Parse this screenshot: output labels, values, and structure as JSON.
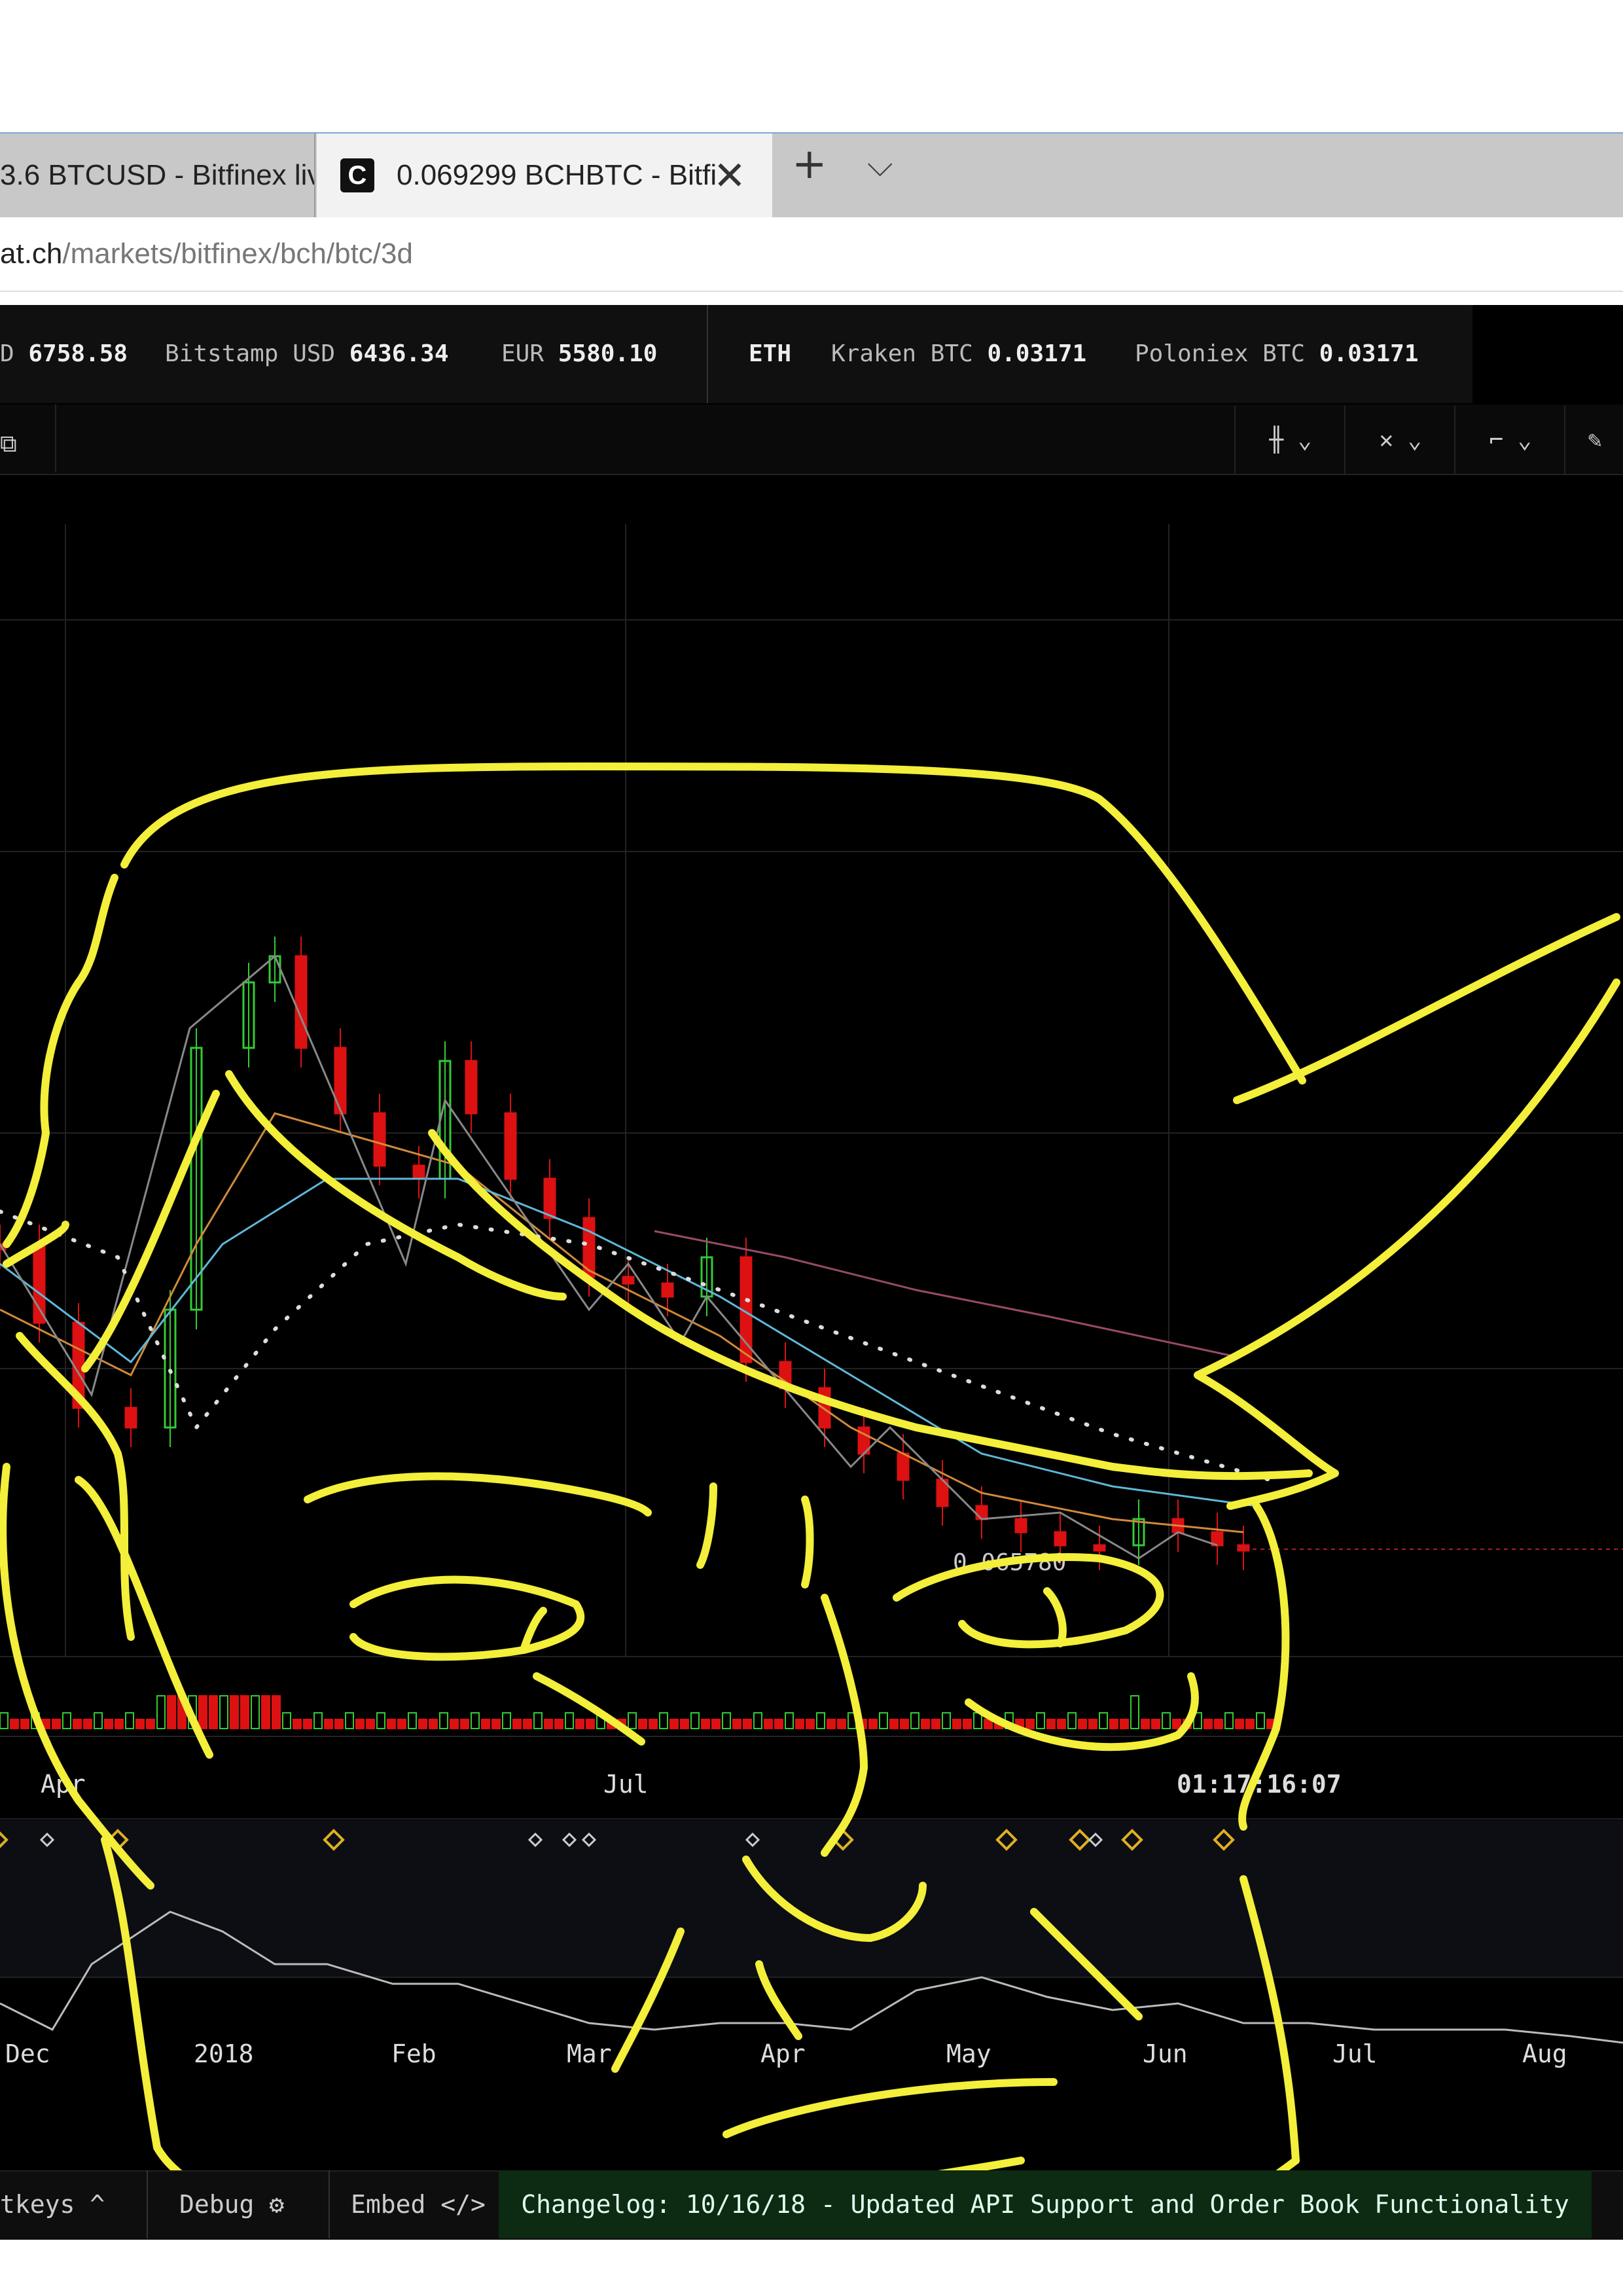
{
  "browser": {
    "tabs": [
      {
        "label": "3.6 BTCUSD - Bitfinex liv"
      },
      {
        "label": "0.069299 BCHBTC - Bitfi",
        "favicon": "C",
        "active": true
      }
    ],
    "new_tab_icon": "plus-icon",
    "tab_menu_icon": "chevron-down-icon",
    "address": {
      "host": "at.ch",
      "path": "/markets/bitfinex/bch/btc/3d"
    }
  },
  "ticker": {
    "items": [
      {
        "label": "D",
        "value": "6758.58"
      },
      {
        "label": "Bitstamp USD",
        "value": "6436.34"
      },
      {
        "label": "EUR",
        "value": "5580.10"
      },
      {
        "label": "ETH",
        "value": ""
      },
      {
        "label": "Kraken BTC",
        "value": "0.03171"
      },
      {
        "label": "Poloniex BTC",
        "value": "0.03171"
      }
    ]
  },
  "toolbar": {
    "left_icon": "window-icon",
    "buttons": [
      {
        "icon": "candles-icon",
        "caret": "⌄"
      },
      {
        "icon": "crosshair-icon",
        "caret": "⌄"
      },
      {
        "icon": "step-line-icon",
        "caret": "⌄"
      },
      {
        "icon": "pencil-icon"
      }
    ]
  },
  "chart_data": {
    "type": "line",
    "price_label": "0.065780",
    "time_countdown": "01:17:16:07",
    "upper_x_labels": [
      "Apr",
      "Jul"
    ],
    "lower_x_labels": [
      "Dec",
      "2018",
      "Feb",
      "Mar",
      "Apr",
      "May",
      "Jun",
      "Jul",
      "Aug"
    ],
    "colors": {
      "up": "#33cc33",
      "down": "#dd1111",
      "ma_orange": "#d08a3a",
      "ma_blue": "#5fb8d8",
      "ma_pink": "#9a4a6a",
      "dots": "#dddddd",
      "overlay": "#f3ef3a",
      "indicator": "#bbbbbb"
    }
  },
  "bottombar": {
    "hotkeys_label": "tkeys ^",
    "debug_label": "Debug ⚙",
    "embed_label": "Embed </>",
    "changelog": "Changelog: 10/16/18 - Updated API Support and Order Book Functionality"
  }
}
